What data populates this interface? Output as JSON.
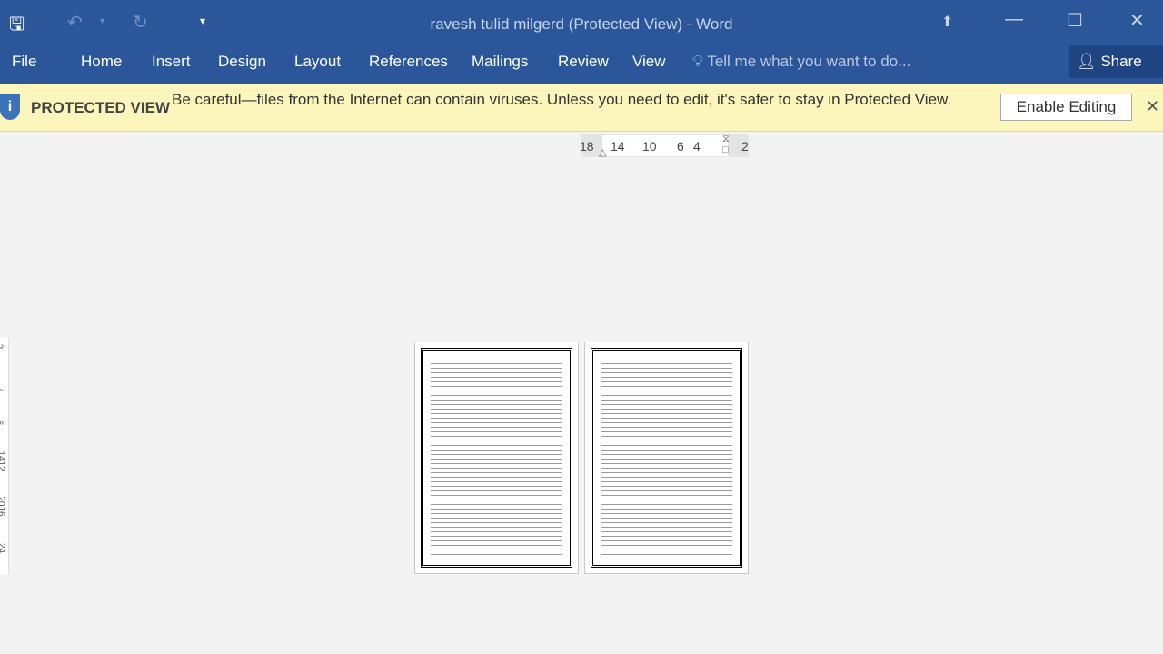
{
  "window": {
    "title": "ravesh tulid milgerd (Protected View) - Word"
  },
  "quick_access": {
    "save_icon": "save-icon",
    "undo_icon": "undo-icon",
    "redo_icon": "redo-icon",
    "customize_icon": "customize-icon"
  },
  "ribbon": {
    "tabs": [
      "File",
      "Home",
      "Insert",
      "Design",
      "Layout",
      "References",
      "Mailings",
      "Review",
      "View"
    ],
    "tell_me": "Tell me what you want to do...",
    "share": "Share"
  },
  "protected_view": {
    "label": "PROTECTED VIEW",
    "message": "Be careful—files from the Internet can contain viruses. Unless you need to edit, it's safer to stay in Protected View.",
    "enable_button": "Enable Editing"
  },
  "horizontal_ruler": [
    "18",
    "14",
    "10",
    "6",
    "4",
    "2"
  ],
  "vertical_ruler": [
    "2",
    "4",
    "6",
    "1412",
    "2016",
    "24"
  ],
  "colors": {
    "ribbon": "#2b579a",
    "banner": "#fdf6bc"
  }
}
